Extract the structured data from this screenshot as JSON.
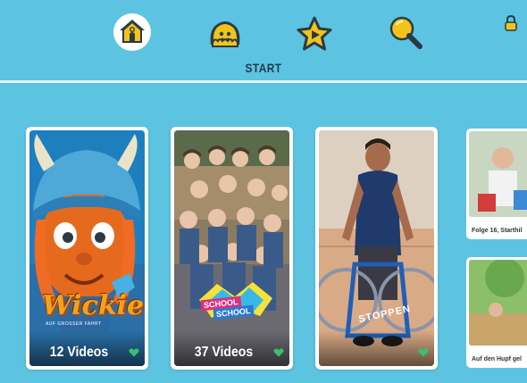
{
  "nav": {
    "label": "START",
    "items": [
      {
        "id": "home",
        "icon": "house-icon"
      },
      {
        "id": "characters",
        "icon": "character-icon"
      },
      {
        "id": "favorites",
        "icon": "star-icon"
      },
      {
        "id": "search",
        "icon": "search-icon"
      }
    ],
    "lock_icon": "lock-icon"
  },
  "colors": {
    "background": "#5cc4e0",
    "nav_active_ring": "#ffffff",
    "icon_yellow": "#f2c31b",
    "icon_dark": "#2b3a44",
    "heart_green": "#38c26b"
  },
  "cards": [
    {
      "title_logo": "Wickie",
      "logo_subtitle": "AUF GROSSER FAHRT",
      "count": "12 Videos"
    },
    {
      "logo_line1": "SCHOOL",
      "logo_line2": "SCHOOL",
      "count": "37 Videos"
    },
    {
      "overlay_text": "STOPPEN",
      "count": ""
    }
  ],
  "side_cards": [
    {
      "caption": "Folge 16, Starthil"
    },
    {
      "caption": "Auf den Hupf gel"
    }
  ]
}
